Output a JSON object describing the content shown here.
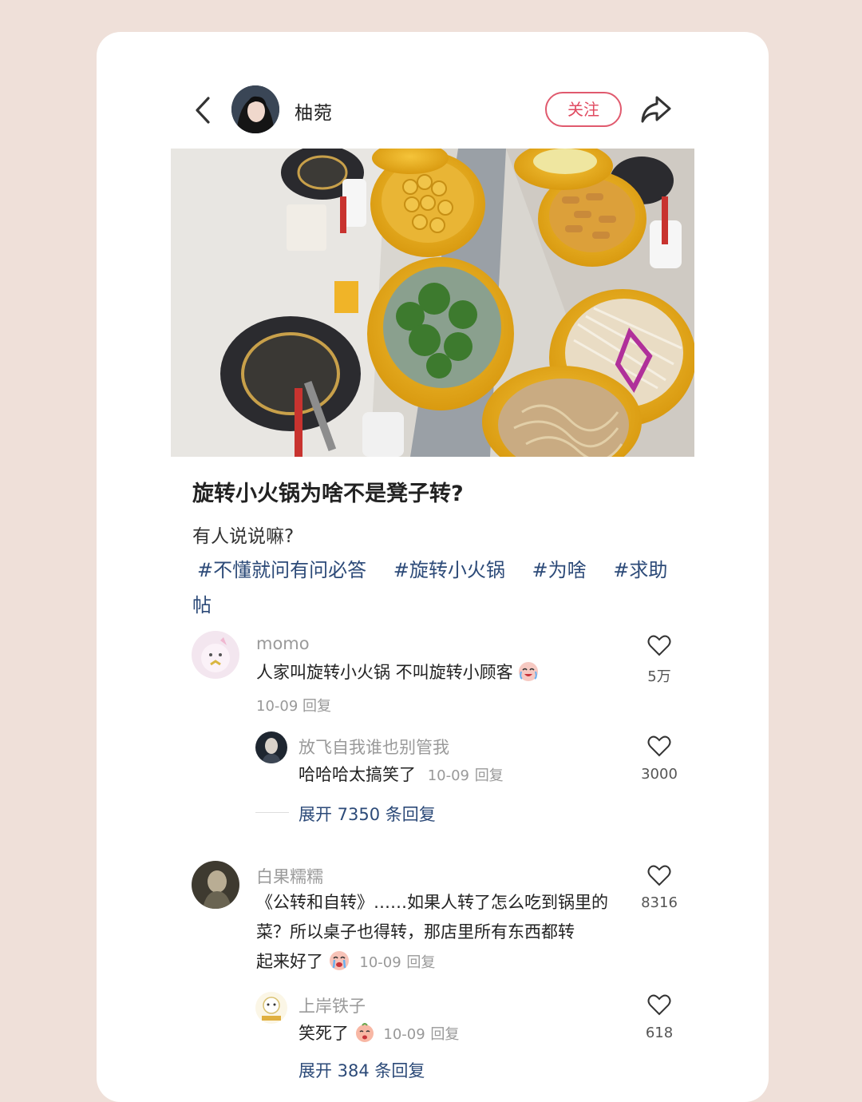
{
  "header": {
    "author_name": "柚菀",
    "follow_label": "关注"
  },
  "post": {
    "title": "旋转小火锅为啥不是凳子转?",
    "body": "有人说说嘛?",
    "tags": [
      "#不懂就问有问必答",
      "#旋转小火锅",
      "#为啥",
      "#求助帖"
    ]
  },
  "comments": [
    {
      "user": "momo",
      "text": "人家叫旋转小火锅 不叫旋转小顾客",
      "date": "10-09",
      "reply_label": "回复",
      "likes": "5万",
      "replies": [
        {
          "user": "放飞自我谁也别管我",
          "text": "哈哈哈太搞笑了",
          "date": "10-09",
          "reply_label": "回复",
          "likes": "3000"
        }
      ],
      "expand_label": "展开 7350 条回复"
    },
    {
      "user": "白果糯糯",
      "text_line1": "《公转和自转》……如果人转了怎么吃到锅里的",
      "text_line2": "菜？所以桌子也得转，那店里所有东西都转",
      "text_line3": "起来好了",
      "date": "10-09",
      "reply_label": "回复",
      "likes": "8316",
      "replies": [
        {
          "user": "上岸铁子",
          "text": "笑死了",
          "date": "10-09",
          "reply_label": "回复",
          "likes": "618"
        }
      ],
      "expand_label": "展开 384 条回复"
    }
  ],
  "colors": {
    "background": "#efe0d9",
    "accent": "#e04a60",
    "tag": "#2c4a78"
  }
}
